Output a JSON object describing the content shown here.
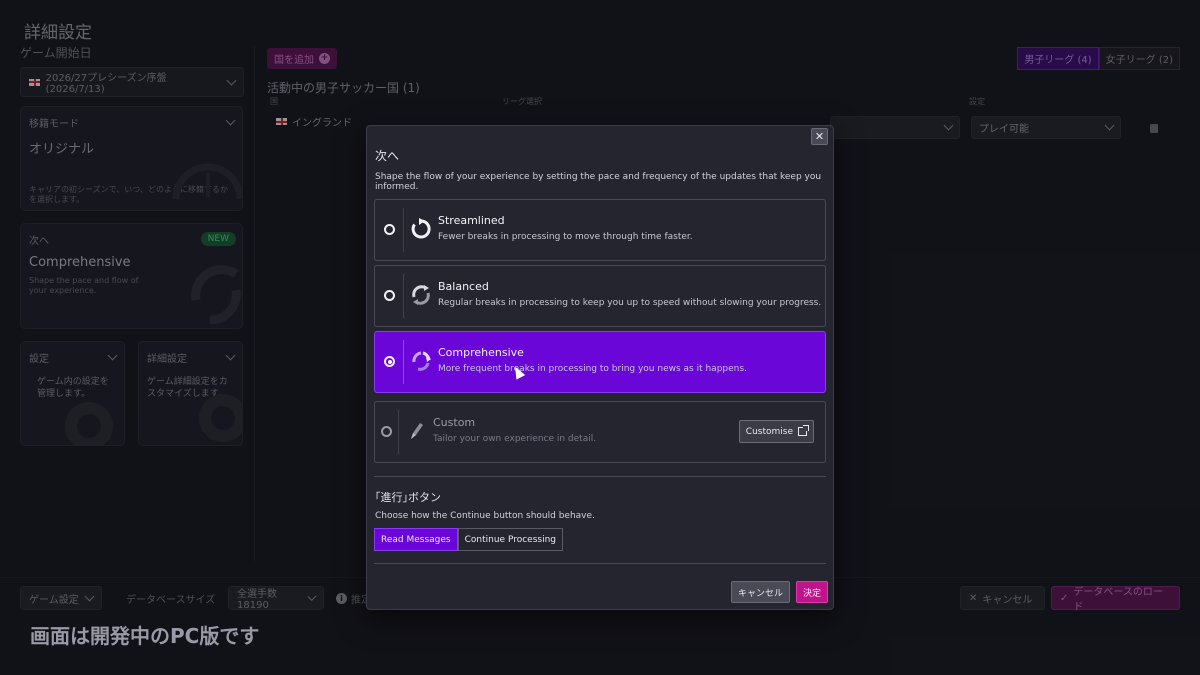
{
  "page": {
    "title": "詳細設定",
    "dev_note": "画面は開発中のPC版です"
  },
  "left": {
    "start_date_label": "ゲーム開始日",
    "start_date_value": "2026/27プレシーズン序盤 (2026/7/13)",
    "transfer": {
      "label": "移籍モード",
      "value": "オリジナル",
      "desc": "キャリアの初シーズンで、いつ、どのように移籍するかを選択します。"
    },
    "next": {
      "label": "次へ",
      "badge": "NEW",
      "value": "Comprehensive",
      "desc": "Shape the pace and flow of your experience."
    },
    "settings": {
      "label": "設定",
      "desc": "ゲーム内の設定を管理します。"
    },
    "advanced": {
      "label": "詳細設定",
      "desc": "ゲーム詳細設定をカスタマイズします。"
    }
  },
  "main": {
    "add_country": "国を追加",
    "tabs": [
      {
        "label": "男子リーグ (4)",
        "active": true
      },
      {
        "label": "女子リーグ (2)",
        "active": false
      }
    ],
    "active_title": "活動中の男子サッカー国 (1)",
    "col_country": "国",
    "col_league": "リーグ選択",
    "col_setting": "設定",
    "country": "イングランド",
    "setting_value": "プレイ可能"
  },
  "bottom": {
    "game_settings": "ゲーム設定",
    "db_size_label": "データベースサイズ",
    "db_size_value": "全選手数 18190",
    "recommend": "推定",
    "cancel": "キャンセル",
    "load_db": "データベースのロード"
  },
  "modal": {
    "title": "次へ",
    "desc": "Shape the flow of your experience by setting the pace and frequency of the updates that keep you informed.",
    "options": [
      {
        "title": "Streamlined",
        "desc": "Fewer breaks in processing to move through time faster.",
        "icon": "fast-forward-icon",
        "selected": false
      },
      {
        "title": "Balanced",
        "desc": "Regular breaks in processing to keep you up to speed without slowing your progress.",
        "icon": "balanced-cycle-icon",
        "selected": false
      },
      {
        "title": "Comprehensive",
        "desc": "More frequent breaks in processing to bring you news as it happens.",
        "icon": "comprehensive-cycle-icon",
        "selected": true
      },
      {
        "title": "Custom",
        "desc": "Tailor your own experience in detail.",
        "icon": "pencil-icon",
        "selected": false
      }
    ],
    "customise": "Customise",
    "continue_title": "｢進行｣ボタン",
    "continue_desc": "Choose how the Continue button should behave.",
    "continue_options": [
      {
        "label": "Read Messages",
        "active": true
      },
      {
        "label": "Continue Processing",
        "active": false
      }
    ],
    "cancel": "キャンセル",
    "ok": "決定"
  },
  "colors": {
    "accent_purple": "#6b06d8",
    "confirm_magenta": "#c0138c",
    "new_badge": "#4ed48c"
  }
}
